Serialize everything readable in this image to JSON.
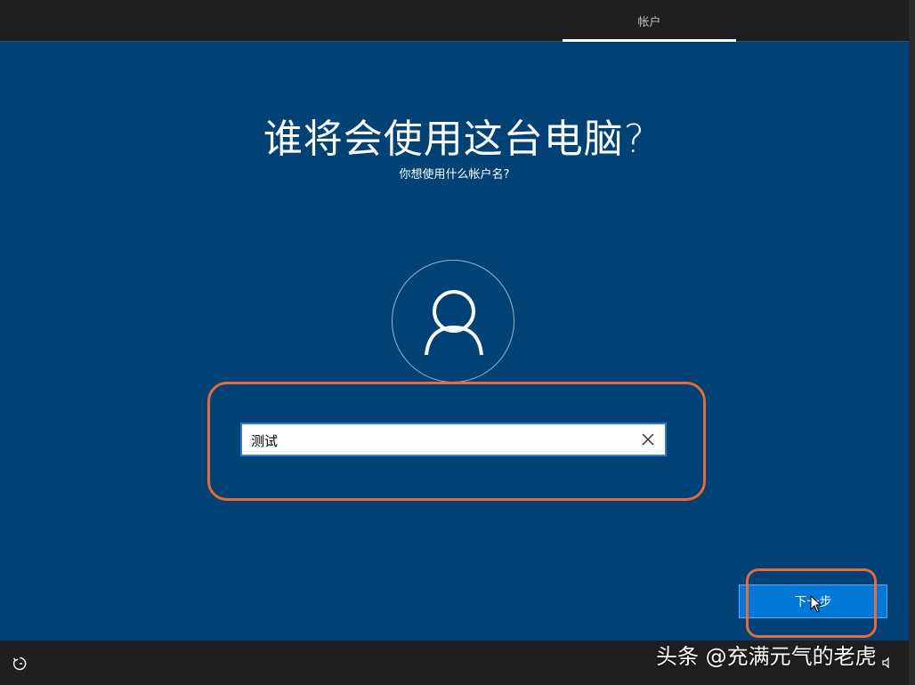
{
  "header": {
    "tab_label": "帐户"
  },
  "main": {
    "title": "谁将会使用这台电脑?",
    "subtitle": "你想使用什么帐户名?",
    "avatar_icon": "user-icon",
    "name_input": {
      "value": "测试",
      "clear_icon": "close-icon"
    },
    "next_button_label": "下一步"
  },
  "footer": {
    "accessibility_icon": "ease-of-access-icon",
    "volume_icon": "volume-icon"
  },
  "watermark": "头条 @充满元气的老虎",
  "colors": {
    "background": "#004275",
    "bars": "#1f1f1f",
    "button": "#0078d7",
    "highlight": "#e96a33"
  }
}
